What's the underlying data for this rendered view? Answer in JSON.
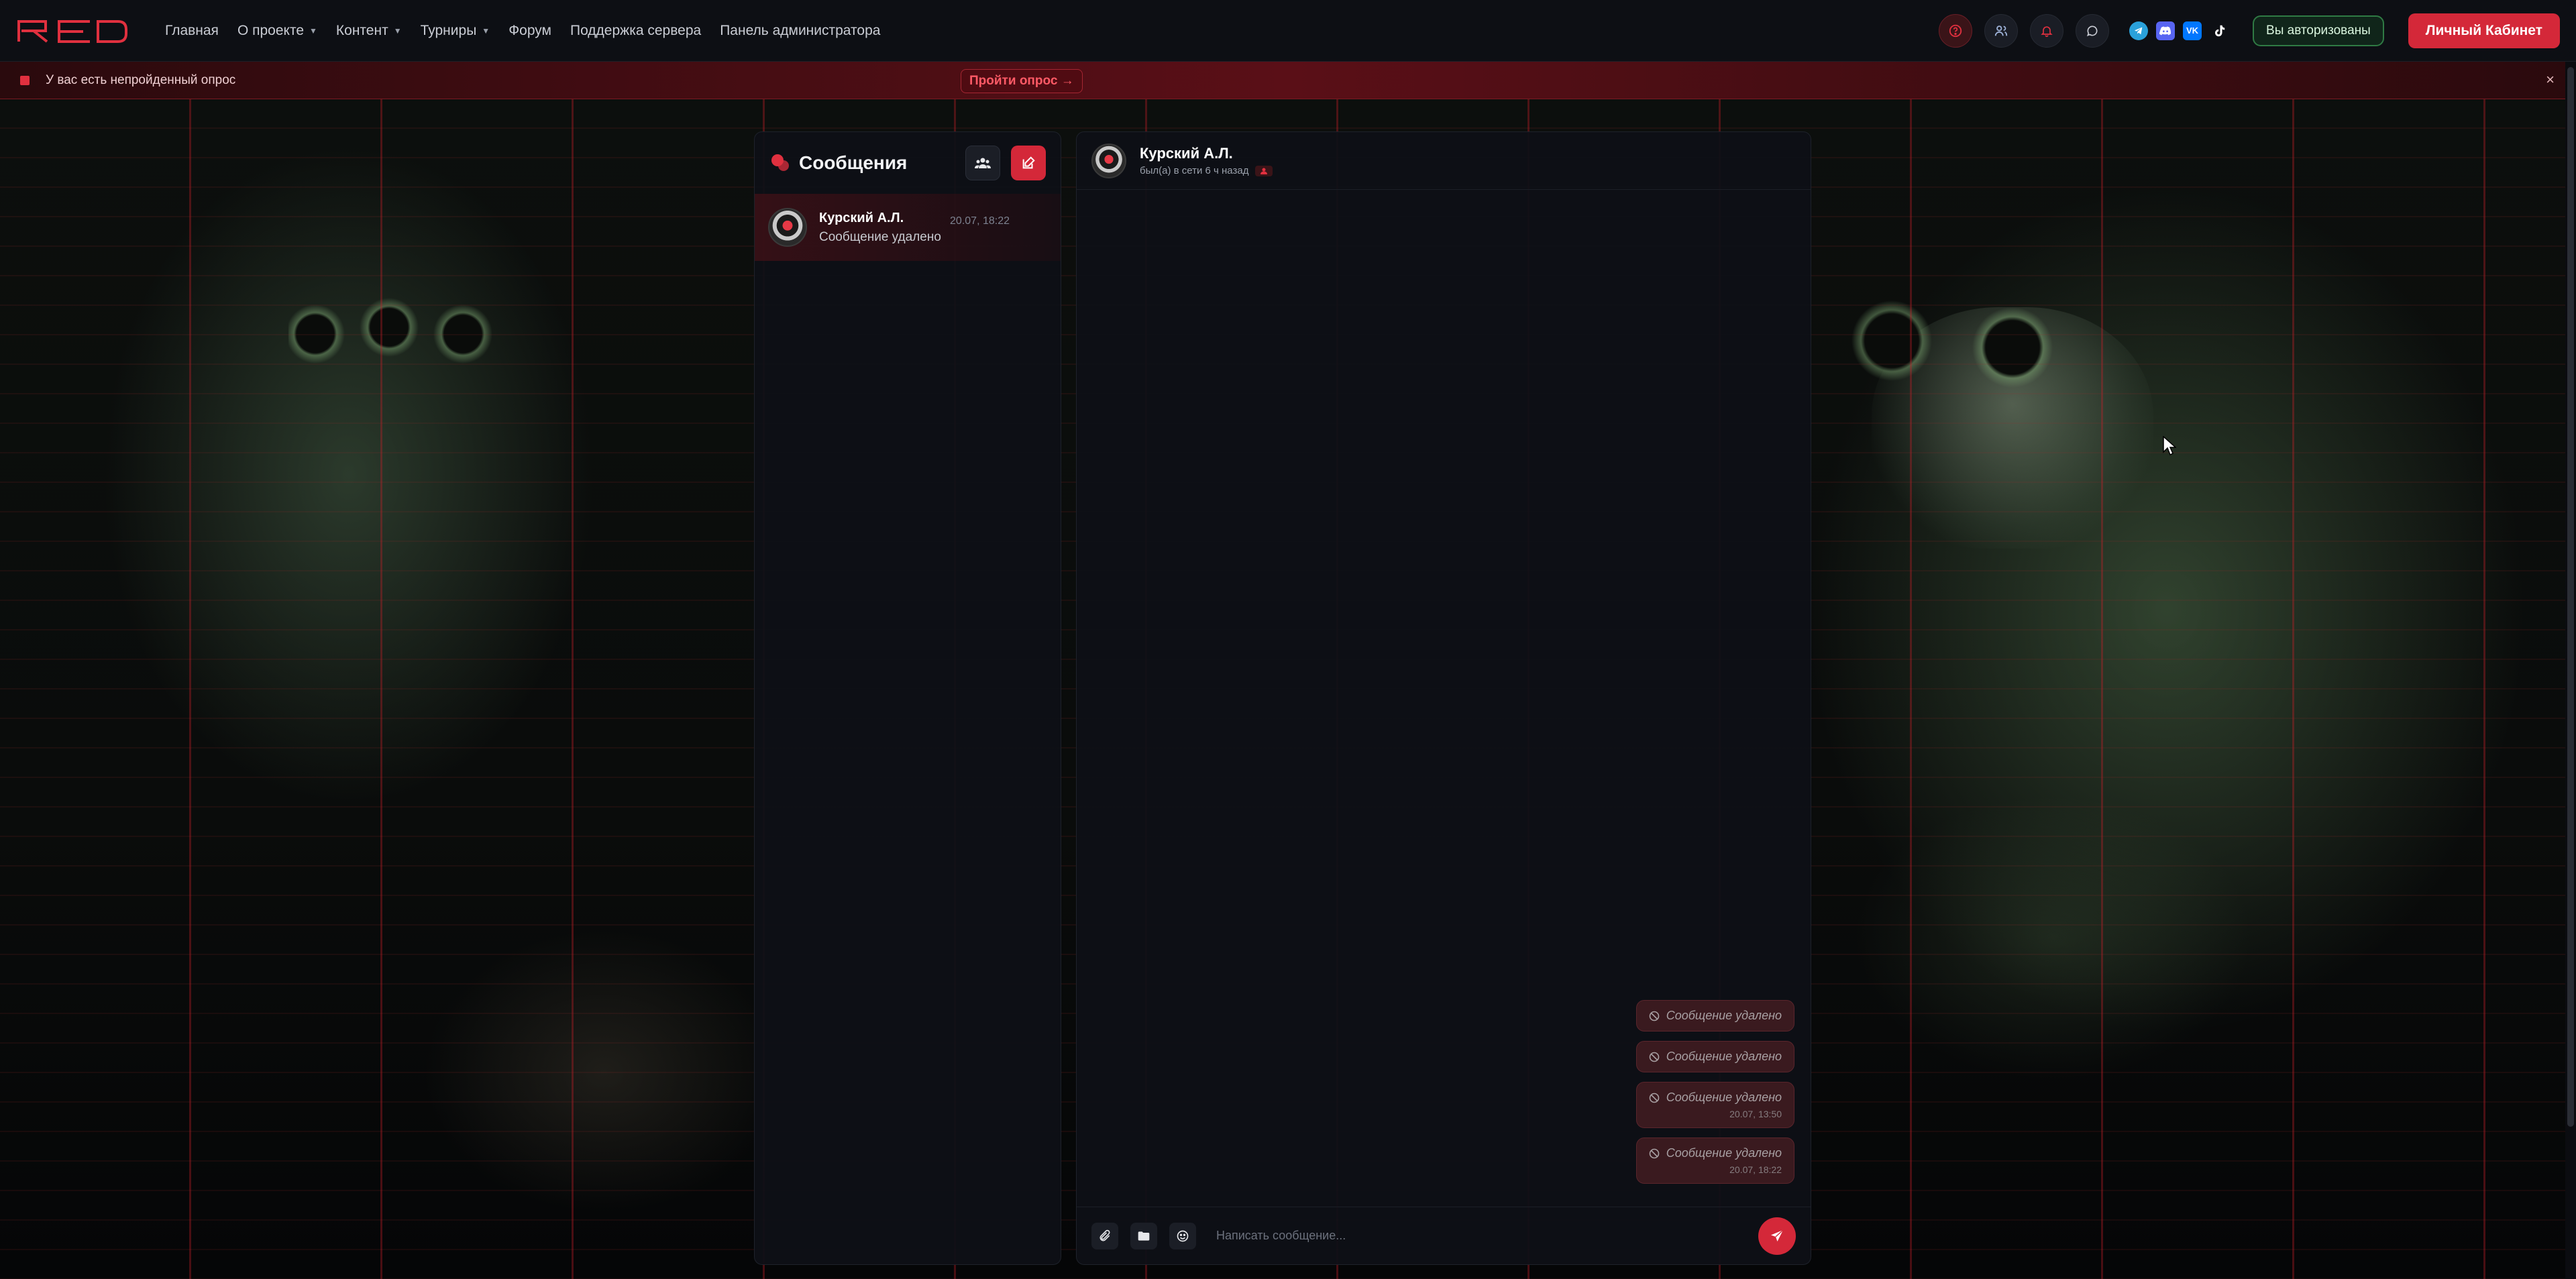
{
  "brand": {
    "logo_text": "RED",
    "accent": "#d42839"
  },
  "nav": {
    "items": [
      {
        "label": "Главная",
        "dropdown": false
      },
      {
        "label": "О проекте",
        "dropdown": true
      },
      {
        "label": "Контент",
        "dropdown": true
      },
      {
        "label": "Турниры",
        "dropdown": true
      },
      {
        "label": "Форум",
        "dropdown": false
      },
      {
        "label": "Поддержка сервера",
        "dropdown": false
      },
      {
        "label": "Панель администратора",
        "dropdown": false
      }
    ]
  },
  "topbar": {
    "icons": [
      "help-icon",
      "users-icon",
      "bell-icon",
      "chat-bubble-icon"
    ],
    "social": [
      "telegram-icon",
      "discord-icon",
      "vk-icon",
      "tiktok-icon"
    ],
    "auth_status": "Вы авторизованы",
    "cabinet_label": "Личный Кабинет"
  },
  "poll_banner": {
    "text": "У вас есть непройденный опрос",
    "action": "Пройти опрос →",
    "close": "×"
  },
  "messages_panel": {
    "title": "Сообщения",
    "conversations": [
      {
        "name": "Курский А.Л.",
        "preview": "Сообщение удалено",
        "time": "20.07, 18:22"
      }
    ]
  },
  "chat": {
    "contact_name": "Курский А.Л.",
    "status": "был(а) в сети 6 ч назад",
    "messages": [
      {
        "text": "Сообщение удалено",
        "time": ""
      },
      {
        "text": "Сообщение удалено",
        "time": ""
      },
      {
        "text": "Сообщение удалено",
        "time": "20.07, 13:50"
      },
      {
        "text": "Сообщение удалено",
        "time": "20.07, 18:22"
      }
    ],
    "composer_placeholder": "Написать сообщение..."
  }
}
